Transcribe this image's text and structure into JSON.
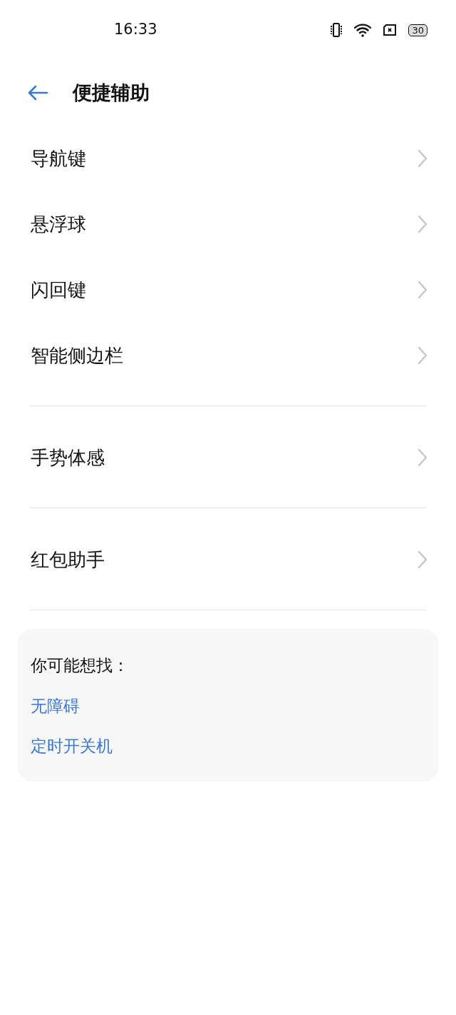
{
  "status_bar": {
    "time": "16:33",
    "battery": "30"
  },
  "header": {
    "title": "便捷辅助"
  },
  "groups": [
    {
      "items": [
        {
          "label": "导航键"
        },
        {
          "label": "悬浮球"
        },
        {
          "label": "闪回键"
        },
        {
          "label": "智能侧边栏"
        }
      ]
    },
    {
      "items": [
        {
          "label": "手势体感"
        }
      ]
    },
    {
      "items": [
        {
          "label": "红包助手"
        }
      ]
    }
  ],
  "suggestions": {
    "title": "你可能想找：",
    "links": [
      "无障碍",
      "定时开关机"
    ]
  }
}
